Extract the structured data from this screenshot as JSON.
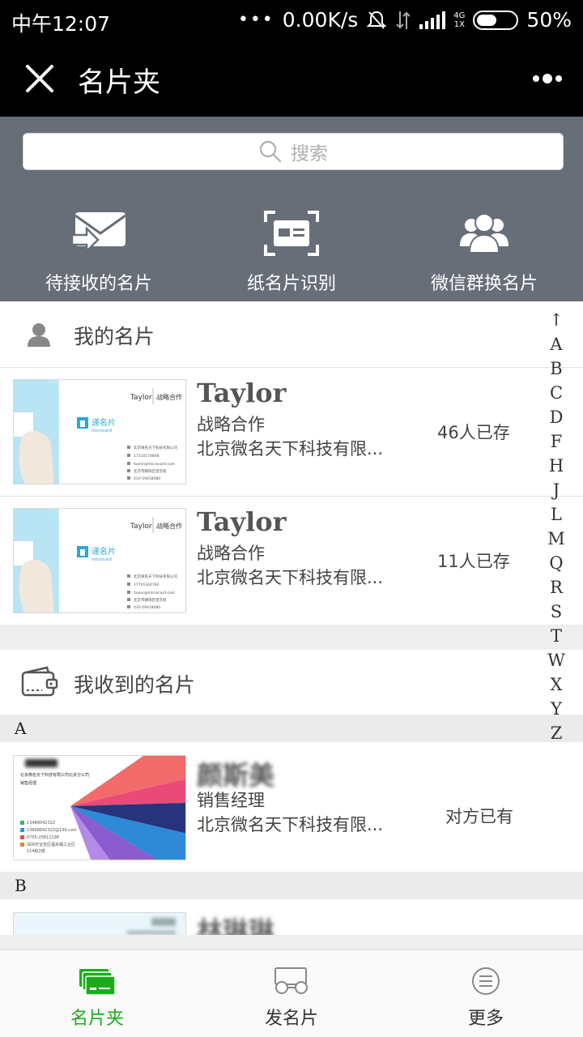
{
  "status_bar": {
    "time": "中午12:07",
    "dots": "•••",
    "speed": "0.00K/s",
    "net_top": "4G",
    "net_bottom": "1X",
    "battery": "50%"
  },
  "title_bar": {
    "title": "名片夹"
  },
  "search": {
    "placeholder": "搜索"
  },
  "quick_actions": [
    {
      "label": "待接收的名片",
      "icon": "envelope-arrow-icon"
    },
    {
      "label": "纸名片识别",
      "icon": "card-scan-icon"
    },
    {
      "label": "微信群换名片",
      "icon": "group-icon"
    }
  ],
  "my_cards": {
    "header": "我的名片",
    "items": [
      {
        "name": "Taylor",
        "title": "战略合作",
        "company": "北京微名天下科技有限...",
        "stat": "46人已存",
        "card": {
          "name": "Taylor",
          "title": "战略合作",
          "brand": "递名片",
          "brand_en": "microcard",
          "lines": [
            "北京微名天下科技有限公司",
            "17310174848",
            "taylor@microcard.com",
            "北京市朝阳区望京街",
            "010-59418080"
          ]
        }
      },
      {
        "name": "Taylor",
        "title": "战略合作",
        "company": "北京微名天下科技有限...",
        "stat": "11人已存",
        "card": {
          "name": "Taylor",
          "title": "战略合作",
          "brand": "递名片",
          "brand_en": "microcard",
          "lines": [
            "北京微名天下科技有限公司",
            "17701344782",
            "taylor@microcard.com",
            "北京市朝阳区望京街",
            "010-59418080"
          ]
        }
      }
    ]
  },
  "received": {
    "header": "我收到的名片",
    "groups": [
      {
        "letter": "A",
        "items": [
          {
            "name": "颜斯美",
            "title": "销售经理",
            "company": "北京微名天下科技有限...",
            "stat": "对方已有",
            "card": {
              "name": "颜斯美",
              "lines": [
                "北京微名天下科技有限公司北京分公司",
                "销售经理",
                "13488042322",
                "13648842322@139.com",
                "0755-25611198",
                "深圳市宝安区福永镇工业区",
                "114栋2楼"
              ]
            }
          }
        ]
      },
      {
        "letter": "B",
        "items": [
          {
            "name": "林琳琳"
          }
        ]
      }
    ]
  },
  "index_letters": [
    "↑",
    "A",
    "B",
    "C",
    "D",
    "F",
    "H",
    "J",
    "L",
    "M",
    "Q",
    "R",
    "S",
    "T",
    "W",
    "X",
    "Y",
    "Z"
  ],
  "bottom_nav": [
    {
      "label": "名片夹",
      "icon": "cards-icon",
      "active": true
    },
    {
      "label": "发名片",
      "icon": "send-card-icon",
      "active": false
    },
    {
      "label": "更多",
      "icon": "menu-icon",
      "active": false
    }
  ],
  "colors": {
    "accent": "#1aad19",
    "header_panel": "#686e78",
    "title_bar": "#000000"
  }
}
